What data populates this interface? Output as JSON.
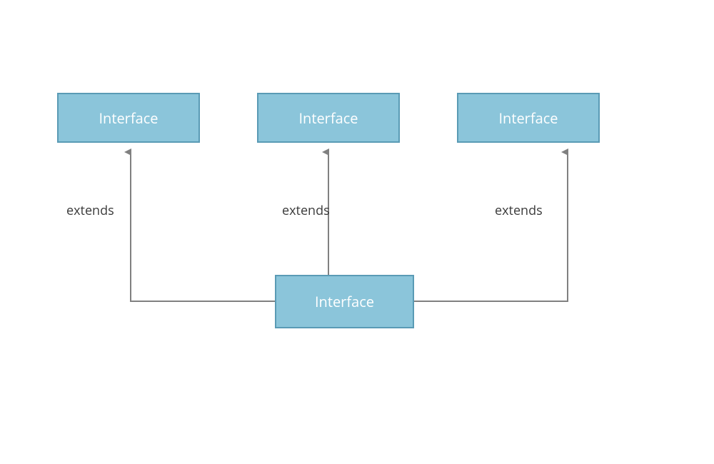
{
  "boxes": {
    "top_left": "Interface",
    "top_center": "Interface",
    "top_right": "Interface",
    "bottom": "Interface"
  },
  "labels": {
    "left": "extends",
    "center": "extends",
    "right": "extends"
  },
  "colors": {
    "box_fill": "#8bc5da",
    "box_border": "#5a9bb5",
    "box_text": "#ffffff",
    "connector": "#808080",
    "label_text": "#3a3a3a"
  }
}
